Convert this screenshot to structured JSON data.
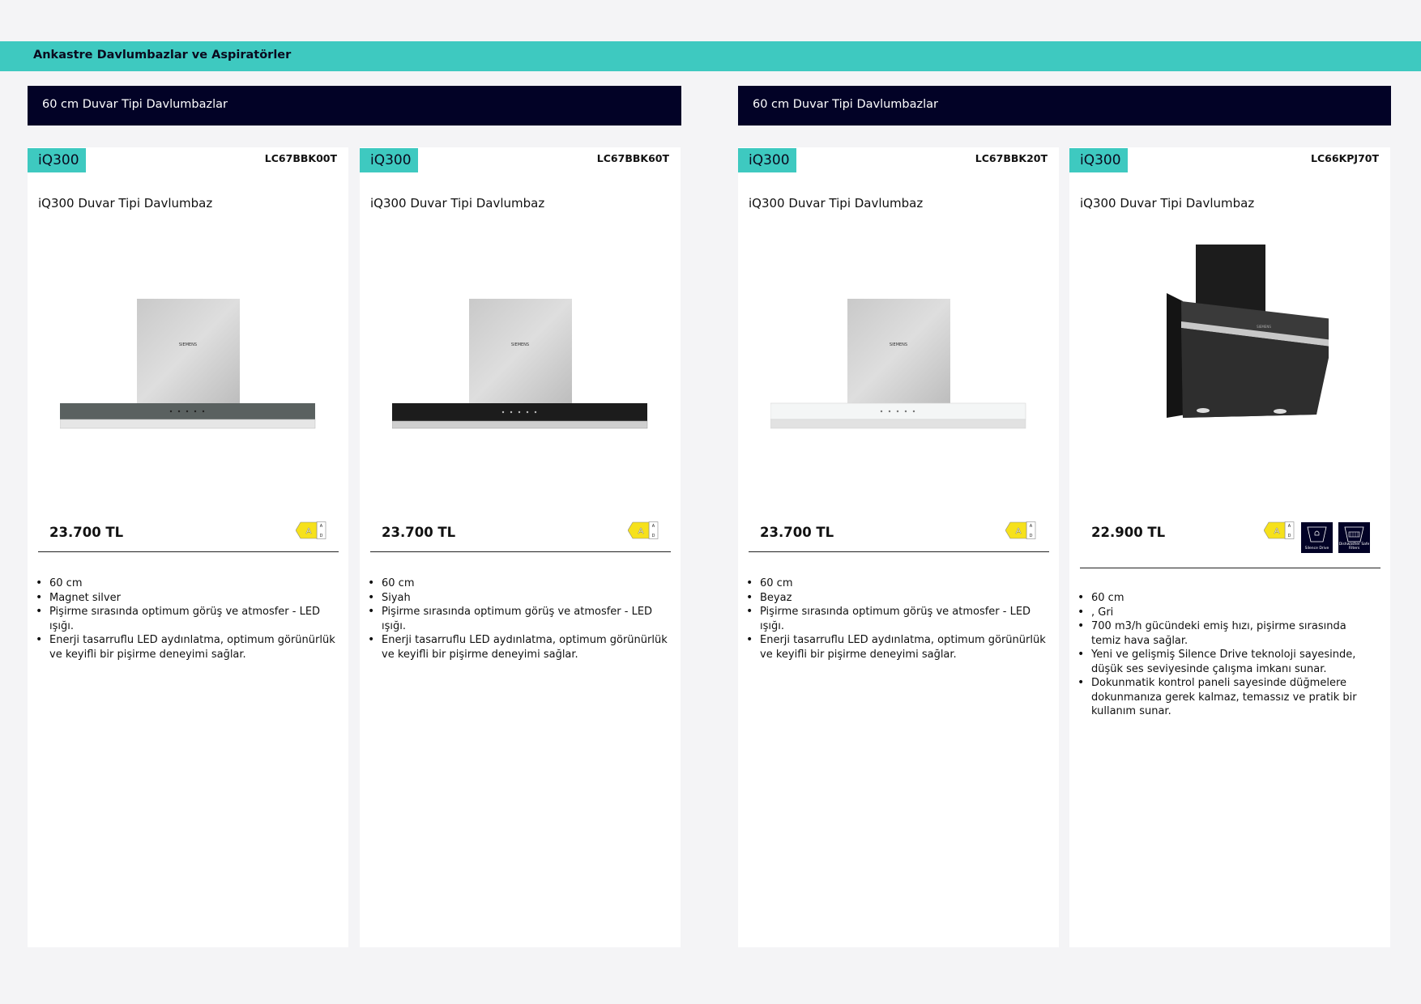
{
  "page": {
    "category_title": "Ankastre Davlumbazlar ve Aspiratörler"
  },
  "sections": [
    {
      "title": "60 cm Duvar Tipi Davlumbazlar"
    },
    {
      "title": "60 cm Duvar Tipi Davlumbazlar"
    }
  ],
  "products": [
    {
      "series": "iQ300",
      "model": "LC67BBK00T",
      "name": "iQ300 Duvar Tipi Davlumbaz",
      "price": "23.700 TL",
      "image": {
        "icon": "hood-box-icon",
        "brand": "SIEMENS",
        "trim_color": "#5a6160"
      },
      "energy_label": {
        "class": "A",
        "scale": [
          "A",
          "D"
        ]
      },
      "features": [
        "60 cm",
        "Magnet silver",
        "Pişirme sırasında optimum görüş ve atmosfer - LED ışığı.",
        "Enerji tasarruflu LED aydınlatma, optimum görünürlük ve keyifli bir pişirme deneyimi sağlar."
      ]
    },
    {
      "series": "iQ300",
      "model": "LC67BBK60T",
      "name": "iQ300 Duvar Tipi Davlumbaz",
      "price": "23.700 TL",
      "image": {
        "icon": "hood-box-icon",
        "brand": "SIEMENS",
        "trim_color": "#1c1c1c"
      },
      "energy_label": {
        "class": "A",
        "scale": [
          "A",
          "D"
        ]
      },
      "features": [
        "60 cm",
        "Siyah",
        "Pişirme sırasında optimum görüş ve atmosfer - LED ışığı.",
        "Enerji tasarruflu LED aydınlatma, optimum görünürlük ve keyifli bir pişirme deneyimi sağlar."
      ]
    },
    {
      "series": "iQ300",
      "model": "LC67BBK20T",
      "name": "iQ300 Duvar Tipi Davlumbaz",
      "price": "23.700 TL",
      "image": {
        "icon": "hood-box-icon",
        "brand": "SIEMENS",
        "trim_color": "#f4f6f6"
      },
      "energy_label": {
        "class": "A",
        "scale": [
          "A",
          "D"
        ]
      },
      "features": [
        "60 cm",
        "Beyaz",
        "Pişirme sırasında optimum görüş ve atmosfer - LED ışığı.",
        "Enerji tasarruflu LED aydınlatma, optimum görünürlük ve keyifli bir pişirme deneyimi sağlar."
      ]
    },
    {
      "series": "iQ300",
      "model": "LC66KPJ70T",
      "name": "iQ300 Duvar Tipi Davlumbaz",
      "price": "22.900 TL",
      "image": {
        "icon": "hood-inclined-icon",
        "brand": "SIEMENS",
        "trim_color": "#2b2b2b"
      },
      "energy_label": {
        "class": "A",
        "scale": [
          "A",
          "D"
        ]
      },
      "feature_icons": [
        {
          "icon": "silence-drive-icon",
          "label": "Silence Drive"
        },
        {
          "icon": "dishwasher-safe-filters-icon",
          "label": "Dishwasher Safe Filters"
        }
      ],
      "features": [
        "60 cm",
        ", Gri",
        "700 m3/h gücündeki emiş hızı, pişirme sırasında temiz hava sağlar.",
        "Yeni ve gelişmiş Silence Drive teknoloji sayesinde, düşük ses seviyesinde çalışma imkanı sunar.",
        "Dokunmatik kontrol paneli sayesinde düğmelere dokunmanıza gerek kalmaz, temassız ve pratik bir kullanım sunar."
      ]
    }
  ],
  "colors": {
    "accent": "#3ec9c0",
    "header_bg": "#020226",
    "page_bg": "#f4f4f6",
    "energy_yellow": "#f6e11c"
  }
}
